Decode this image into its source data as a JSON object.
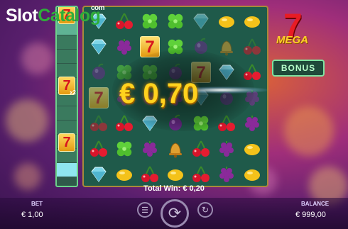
{
  "watermark": {
    "part1": "Slot",
    "part2": "Catalog",
    "suffix": "com"
  },
  "logo": {
    "seven": "7",
    "word": "MEGA"
  },
  "bonus": {
    "label": "BONUS"
  },
  "win": {
    "amount": "€ 0,70"
  },
  "total_win": {
    "text": "Total Win: € 0,20"
  },
  "side_strip": {
    "cells": [
      "seven",
      "lit",
      "plain",
      "plain",
      "plain",
      "seven-x2",
      "plain",
      "plain",
      "plain",
      "seven",
      "plain",
      "last"
    ],
    "multiplier": "x2"
  },
  "reels": {
    "rows": [
      [
        "diamond",
        "cherry",
        "clover",
        "clover",
        "diamond",
        "lemon",
        "lemon"
      ],
      [
        "diamond",
        "grape",
        "seven",
        "clover",
        "plum",
        "bell",
        "cherry"
      ],
      [
        "plum",
        "clover",
        "clover",
        "plum",
        "seven",
        "diamond",
        "cherry"
      ],
      [
        "seven",
        "grape",
        "plum",
        "grape",
        "diamond",
        "plum",
        "grape"
      ],
      [
        "cherry",
        "cherry",
        "diamond",
        "plum",
        "clover",
        "cherry",
        "grape"
      ],
      [
        "cherry",
        "clover",
        "grape",
        "bell",
        "cherry",
        "grape",
        "lemon"
      ],
      [
        "diamond",
        "lemon",
        "cherry",
        "lemon",
        "cherry",
        "grape",
        "lemon"
      ]
    ]
  },
  "bottom": {
    "bet_label": "BET",
    "bet_value": "€ 1,00",
    "balance_label": "BALANCE",
    "balance_value": "€ 999,00"
  },
  "colors": {
    "accent": "#ffd21e",
    "panel_border": "#7ce3a0"
  }
}
